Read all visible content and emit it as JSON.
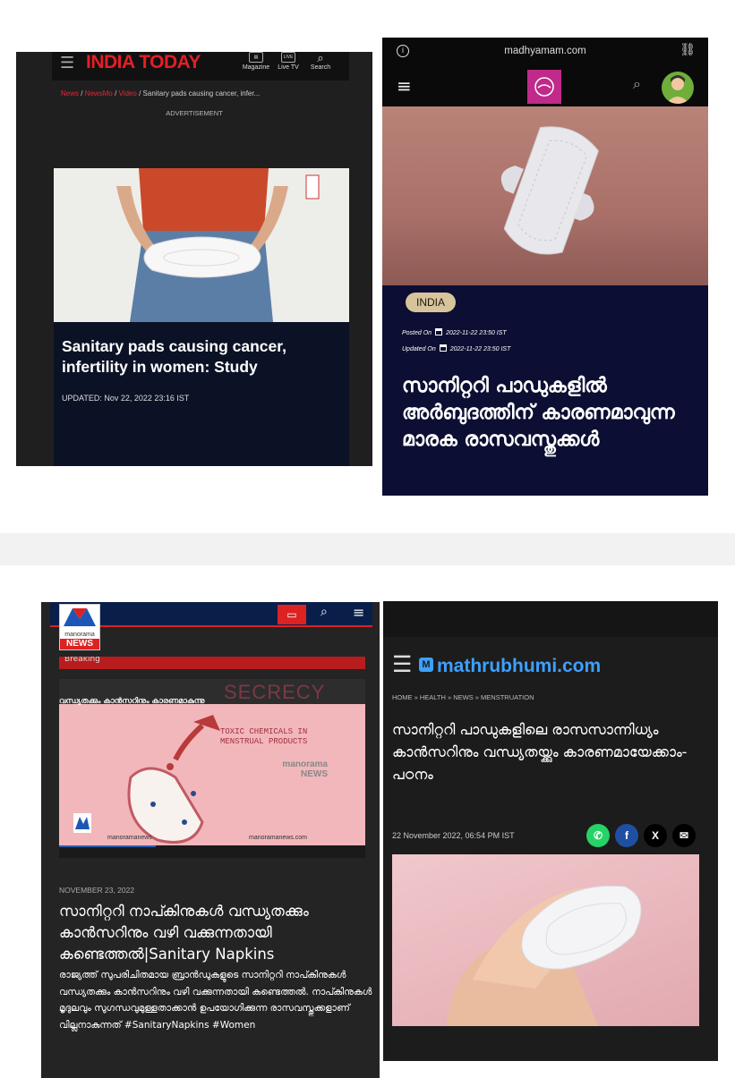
{
  "india_today": {
    "logo": "INDIA TODAY",
    "icons": [
      {
        "label": "Magazine",
        "name": "magazine-icon"
      },
      {
        "label": "Live TV",
        "name": "live-tv-icon"
      },
      {
        "label": "Search",
        "name": "search-icon"
      }
    ],
    "breadcrumb": {
      "items": [
        "News",
        "NewsMo",
        "Video"
      ],
      "current": "Sanitary pads causing cancer, infer..."
    },
    "advertisement": "ADVERTISEMENT",
    "headline": "Sanitary pads causing cancer, infertility in women: Study",
    "updated": "UPDATED: Nov 22, 2022 23:16 IST"
  },
  "madhyamam": {
    "url": "madhyamam.com",
    "category": "INDIA",
    "posted_label": "Posted On",
    "posted_date": "2022-11-22 23:50 IST",
    "updated_label": "Updated On",
    "updated_date": "2022-11-22 23:50 IST",
    "title": "സാനിറ്ററി പാഡുകളിൽ അർബുദത്തിന് കാരണമാവുന്ന മാരക രാസവസ്തുക്കൾ"
  },
  "manorama": {
    "logo_top": "manorama",
    "logo_bottom": "NEWS",
    "breaking": "Breaking",
    "media_title": "വന്ധ്യതക്കും കാൻസറിനും കാരണമാകുന്നു",
    "media_heading_1": "SECRECY",
    "media_subheading": "TOXIC CHEMICALS IN MENSTRUAL PRODUCTS",
    "watermark": "manorama NEWS",
    "handle": "manoramanews",
    "site": "manoramanews.com",
    "date": "NOVEMBER 23, 2022",
    "title": "സാനിറ്ററി നാപ്കിനുകൾ വന്ധ്യതക്കും കാൻസറിനും വഴി വക്കുന്നതായി കണ്ടെത്തൽ|Sanitary Napkins",
    "description": "രാജ്യത്ത് സുപരിചിതമായ ബ്രാൻഡുകളുടെ സാനിറ്ററി നാപ്കിനുകൾ വന്ധ്യതക്കും കാൻസറിനും വഴി വക്കുന്നതായി കണ്ടെത്തൽ. നാപ്കിനുകൾ മൃദുലവും സുഗന്ധവുമുള്ളതാക്കാൻ ഉപയോഗിക്കുന്ന രാസവസ്തുക്കളാണ് വില്ലനാകുന്നത് #SanitaryNapkins #Women"
  },
  "mathrubhumi": {
    "brand": "mathrubhumi.com",
    "brand_mark": "M",
    "breadcrumb": "HOME » HEALTH » NEWS » MENSTRUATION",
    "title": "സാനിറ്ററി പാഡുകളിലെ രാസസാന്നിധ്യം കാൻസറിനും വന്ധ്യതയ്ക്കും കാരണമായേക്കാം- പഠനം",
    "date": "22 November 2022, 06:54 PM IST",
    "share": [
      {
        "name": "whatsapp-icon",
        "glyph": "✆",
        "color": "#25d366"
      },
      {
        "name": "facebook-icon",
        "glyph": "f",
        "color": "#1f4fa3"
      },
      {
        "name": "x-icon",
        "glyph": "X",
        "color": "#000000"
      },
      {
        "name": "email-icon",
        "glyph": "✉",
        "color": "#000000"
      }
    ]
  },
  "colors": {
    "india_today_red": "#e41f26",
    "madhyamam_navy": "#0c0f33",
    "manorama_blue": "#0a1e4a",
    "mathrubhumi_blue": "#3da0ff"
  }
}
